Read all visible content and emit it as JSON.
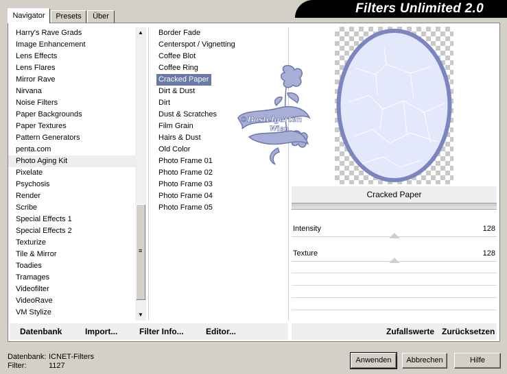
{
  "tabs": [
    {
      "label": "Navigator",
      "active": true
    },
    {
      "label": "Presets",
      "active": false
    },
    {
      "label": "Über",
      "active": false
    }
  ],
  "app_title": "Filters Unlimited 2.0",
  "categories": [
    "Harry's Rave Grads",
    "Image Enhancement",
    "Lens Effects",
    "Lens Flares",
    "Mirror Rave",
    "Nirvana",
    "Noise Filters",
    "Paper Backgrounds",
    "Paper Textures",
    "Pattern Generators",
    "penta.com",
    "Photo Aging Kit",
    "Pixelate",
    "Psychosis",
    "Render",
    "Scribe",
    "Special Effects 1",
    "Special Effects 2",
    "Texturize",
    "Tile & Mirror",
    "Toadies",
    "Tramages",
    "Videofilter",
    "VideoRave",
    "VM Stylize"
  ],
  "selected_category": "Photo Aging Kit",
  "filters": [
    "Border Fade",
    "Centerspot / Vignetting",
    "Coffee Blot",
    "Coffee Ring",
    "Cracked Paper",
    "Dirt & Dust",
    "Dirt",
    "Dust & Scratches",
    "Film Grain",
    "Hairs & Dust",
    "Old Color",
    "Photo Frame 01",
    "Photo Frame 02",
    "Photo Frame 03",
    "Photo Frame 04",
    "Photo Frame 05"
  ],
  "selected_filter": "Cracked Paper",
  "watermark": {
    "line1": "©Bastelgarten",
    "line2": "Wien"
  },
  "preview": {
    "filter_name": "Cracked Paper"
  },
  "params": [
    {
      "label": "Intensity",
      "value": "128",
      "level": 0.5
    },
    {
      "label": "Texture",
      "value": "128",
      "level": 0.5
    }
  ],
  "buttons_left": {
    "database": "Datenbank",
    "import": "Import...",
    "filter_info": "Filter Info...",
    "editor": "Editor..."
  },
  "buttons_right": {
    "random": "Zufallswerte",
    "reset": "Zurücksetzen"
  },
  "status": {
    "db_label": "Datenbank:",
    "db_value": "ICNET-Filters",
    "filter_label": "Filter:",
    "filter_value": "1127"
  },
  "dialog_buttons": {
    "apply": "Anwenden",
    "cancel": "Abbrechen",
    "help": "Hilfe"
  },
  "colors": {
    "selection": "#6a7aa8",
    "preview_frame": "#7b86c0",
    "preview_fill": "#e4e8fb"
  }
}
